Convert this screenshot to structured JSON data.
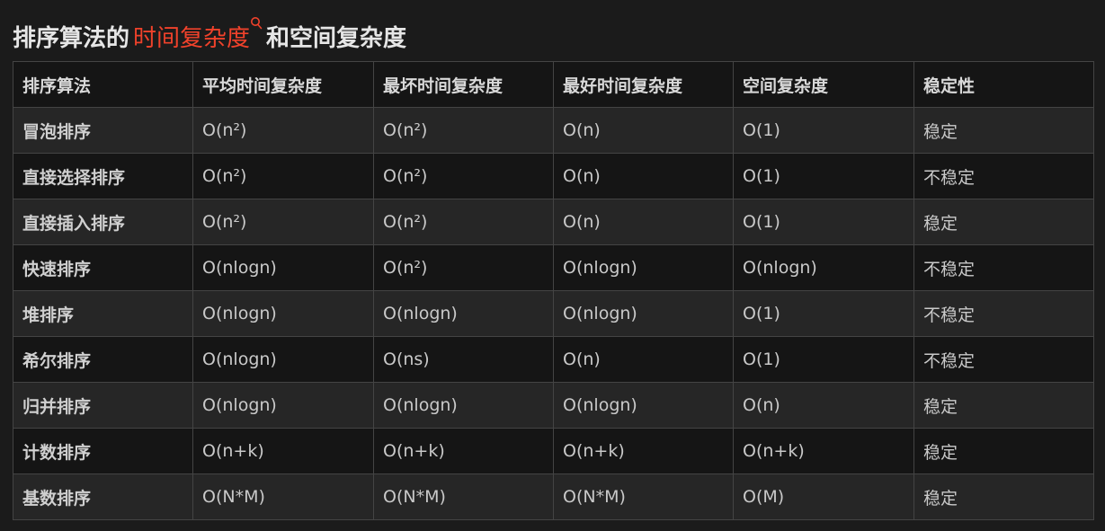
{
  "heading": {
    "prefix": "排序算法的",
    "link": "时间复杂度",
    "suffix": "和空间复杂度"
  },
  "table": {
    "columns": [
      "排序算法",
      "平均时间复杂度",
      "最坏时间复杂度",
      "最好时间复杂度",
      "空间复杂度",
      "稳定性"
    ],
    "rows": [
      [
        "冒泡排序",
        "O(n²)",
        "O(n²)",
        "O(n)",
        "O(1)",
        "稳定"
      ],
      [
        "直接选择排序",
        "O(n²)",
        "O(n²)",
        "O(n)",
        "O(1)",
        "不稳定"
      ],
      [
        "直接插入排序",
        "O(n²)",
        "O(n²)",
        "O(n)",
        "O(1)",
        "稳定"
      ],
      [
        "快速排序",
        "O(nlogn)",
        "O(n²)",
        "O(nlogn)",
        "O(nlogn)",
        "不稳定"
      ],
      [
        "堆排序",
        "O(nlogn)",
        "O(nlogn)",
        "O(nlogn)",
        "O(1)",
        "不稳定"
      ],
      [
        "希尔排序",
        "O(nlogn)",
        "O(ns)",
        "O(n)",
        "O(1)",
        "不稳定"
      ],
      [
        "归并排序",
        "O(nlogn)",
        "O(nlogn)",
        "O(nlogn)",
        "O(n)",
        "稳定"
      ],
      [
        "计数排序",
        "O(n+k)",
        "O(n+k)",
        "O(n+k)",
        "O(n+k)",
        "稳定"
      ],
      [
        "基数排序",
        "O(N*M)",
        "O(N*M)",
        "O(N*M)",
        "O(M)",
        "稳定"
      ]
    ]
  },
  "colors": {
    "background": "#1b1b1b",
    "link": "#f0422b",
    "border": "#444444"
  }
}
